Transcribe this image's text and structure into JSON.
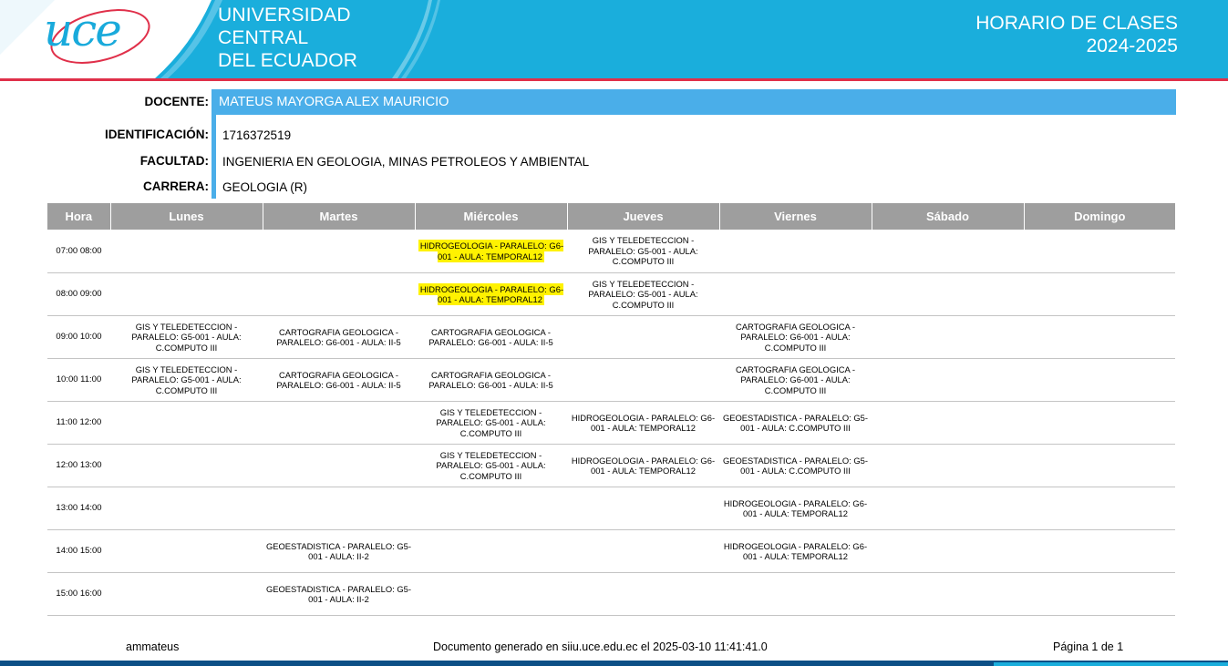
{
  "header": {
    "logo": "uce",
    "university_line1": "UNIVERSIDAD",
    "university_line2": "CENTRAL",
    "university_line3": "DEL ECUADOR",
    "title_line1": "HORARIO DE CLASES",
    "title_line2": "2024-2025",
    "colors": {
      "brand_blue": "#1aaedc",
      "accent_red": "#e0304a"
    }
  },
  "info": {
    "docente_label": "DOCENTE:",
    "docente_value": "MATEUS MAYORGA ALEX MAURICIO",
    "id_label": "IDENTIFICACIÓN:",
    "id_value": "1716372519",
    "facultad_label": "FACULTAD:",
    "facultad_value": "INGENIERIA EN GEOLOGIA, MINAS PETROLEOS Y AMBIENTAL",
    "carrera_label": "CARRERA:",
    "carrera_value": "GEOLOGIA (R)"
  },
  "table": {
    "headers": [
      "Hora",
      "Lunes",
      "Martes",
      "Miércoles",
      "Jueves",
      "Viernes",
      "Sábado",
      "Domingo"
    ],
    "highlight_color": "#fff200",
    "rows": [
      {
        "hora": "07:00 08:00",
        "cells": [
          "",
          "",
          "HIDROGEOLOGIA - PARALELO: G6-001 - AULA: TEMPORAL12",
          "GIS Y TELEDETECCION - PARALELO: G5-001 - AULA: C.COMPUTO III",
          "",
          "",
          ""
        ],
        "highlighted": [
          false,
          false,
          true,
          false,
          false,
          false,
          false
        ]
      },
      {
        "hora": "08:00 09:00",
        "cells": [
          "",
          "",
          "HIDROGEOLOGIA - PARALELO: G6-001 - AULA: TEMPORAL12",
          "GIS Y TELEDETECCION - PARALELO: G5-001 - AULA: C.COMPUTO III",
          "",
          "",
          ""
        ],
        "highlighted": [
          false,
          false,
          true,
          false,
          false,
          false,
          false
        ]
      },
      {
        "hora": "09:00 10:00",
        "cells": [
          "GIS Y TELEDETECCION - PARALELO: G5-001 - AULA: C.COMPUTO III",
          "CARTOGRAFIA GEOLOGICA - PARALELO: G6-001 - AULA: II-5",
          "CARTOGRAFIA GEOLOGICA - PARALELO: G6-001 - AULA: II-5",
          "",
          "CARTOGRAFIA GEOLOGICA - PARALELO: G6-001 - AULA: C.COMPUTO III",
          "",
          ""
        ],
        "highlighted": [
          false,
          false,
          false,
          false,
          false,
          false,
          false
        ]
      },
      {
        "hora": "10:00 11:00",
        "cells": [
          "GIS Y TELEDETECCION - PARALELO: G5-001 - AULA: C.COMPUTO III",
          "CARTOGRAFIA GEOLOGICA - PARALELO: G6-001 - AULA: II-5",
          "CARTOGRAFIA GEOLOGICA - PARALELO: G6-001 - AULA: II-5",
          "",
          "CARTOGRAFIA GEOLOGICA - PARALELO: G6-001 - AULA: C.COMPUTO III",
          "",
          ""
        ],
        "highlighted": [
          false,
          false,
          false,
          false,
          false,
          false,
          false
        ]
      },
      {
        "hora": "11:00 12:00",
        "cells": [
          "",
          "",
          "GIS Y TELEDETECCION - PARALELO: G5-001 - AULA: C.COMPUTO III",
          "HIDROGEOLOGIA - PARALELO: G6-001 - AULA: TEMPORAL12",
          "GEOESTADISTICA - PARALELO: G5-001 - AULA: C.COMPUTO III",
          "",
          ""
        ],
        "highlighted": [
          false,
          false,
          false,
          false,
          false,
          false,
          false
        ]
      },
      {
        "hora": "12:00 13:00",
        "cells": [
          "",
          "",
          "GIS Y TELEDETECCION - PARALELO: G5-001 - AULA: C.COMPUTO III",
          "HIDROGEOLOGIA - PARALELO: G6-001 - AULA: TEMPORAL12",
          "GEOESTADISTICA - PARALELO: G5-001 - AULA: C.COMPUTO III",
          "",
          ""
        ],
        "highlighted": [
          false,
          false,
          false,
          false,
          false,
          false,
          false
        ]
      },
      {
        "hora": "13:00 14:00",
        "cells": [
          "",
          "",
          "",
          "",
          "HIDROGEOLOGIA - PARALELO: G6-001 - AULA: TEMPORAL12",
          "",
          ""
        ],
        "highlighted": [
          false,
          false,
          false,
          false,
          false,
          false,
          false
        ]
      },
      {
        "hora": "14:00 15:00",
        "cells": [
          "",
          "GEOESTADISTICA - PARALELO: G5-001 - AULA: II-2",
          "",
          "",
          "HIDROGEOLOGIA - PARALELO: G6-001 - AULA: TEMPORAL12",
          "",
          ""
        ],
        "highlighted": [
          false,
          false,
          false,
          false,
          false,
          false,
          false
        ]
      },
      {
        "hora": "15:00 16:00",
        "cells": [
          "",
          "GEOESTADISTICA - PARALELO: G5-001 - AULA: II-2",
          "",
          "",
          "",
          "",
          ""
        ],
        "highlighted": [
          false,
          false,
          false,
          false,
          false,
          false,
          false
        ]
      }
    ]
  },
  "footer": {
    "user": "ammateus",
    "generated": "Documento generado en siiu.uce.edu.ec el 2025-03-10 11:41:41.0",
    "page": "Página 1 de 1",
    "colors": {
      "bar": "#0c4f86"
    }
  }
}
